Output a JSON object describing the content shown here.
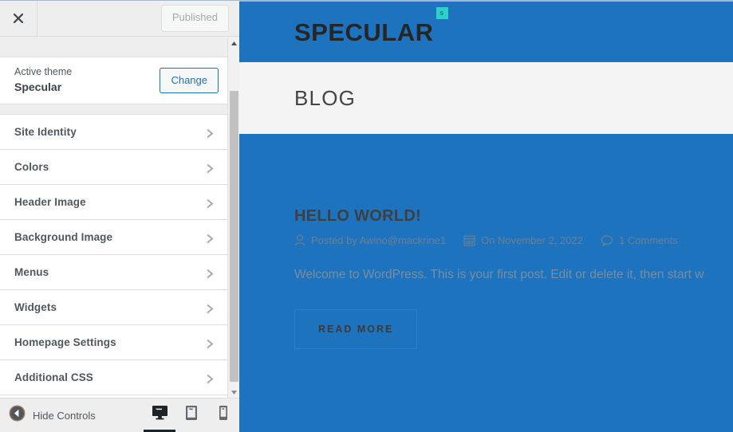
{
  "customizer": {
    "close_icon": "close-x-icon",
    "publish_button": "Published",
    "theme": {
      "label": "Active theme",
      "name": "Specular",
      "change_button": "Change"
    },
    "sections": [
      {
        "title": "Site Identity",
        "chevron": "chevron-right-icon"
      },
      {
        "title": "Colors",
        "chevron": "chevron-right-icon"
      },
      {
        "title": "Header Image",
        "chevron": "chevron-right-icon"
      },
      {
        "title": "Background Image",
        "chevron": "chevron-right-icon"
      },
      {
        "title": "Menus",
        "chevron": "chevron-right-icon"
      },
      {
        "title": "Widgets",
        "chevron": "chevron-right-icon"
      },
      {
        "title": "Homepage Settings",
        "chevron": "chevron-right-icon"
      },
      {
        "title": "Additional CSS",
        "chevron": "chevron-right-icon"
      }
    ],
    "footer": {
      "hide_controls_label": "Hide Controls",
      "hide_controls_icon": "collapse-left-circle-icon",
      "devices": [
        {
          "name": "desktop",
          "icon": "desktop-icon",
          "active": true
        },
        {
          "name": "tablet",
          "icon": "tablet-icon",
          "active": false
        },
        {
          "name": "mobile",
          "icon": "mobile-icon",
          "active": false
        }
      ]
    },
    "scrollbar": {
      "up_icon": "scroll-up-arrow-icon",
      "down_icon": "scroll-down-arrow-icon"
    }
  },
  "preview": {
    "site_logo": "SPECULAR",
    "site_logo_badge": "s",
    "page_title": "BLOG",
    "post": {
      "title": "HELLO WORLD!",
      "author_icon": "user-icon",
      "author": "Posted by Awino@mackrine1",
      "date_icon": "calendar-icon",
      "date": "On November 2, 2022",
      "comments_icon": "comment-bubble-icon",
      "comments": "1 Comments",
      "excerpt": "Welcome to WordPress. This is your first post. Edit or delete it, then start w",
      "read_more": "READ MORE"
    }
  },
  "colors": {
    "preview_background": "#1e73be",
    "banner_background": "#f4f4f4",
    "badge_accent": "#2ad2c9",
    "sidebar_background": "#eeeeee",
    "link_accent": "#2271b1"
  }
}
